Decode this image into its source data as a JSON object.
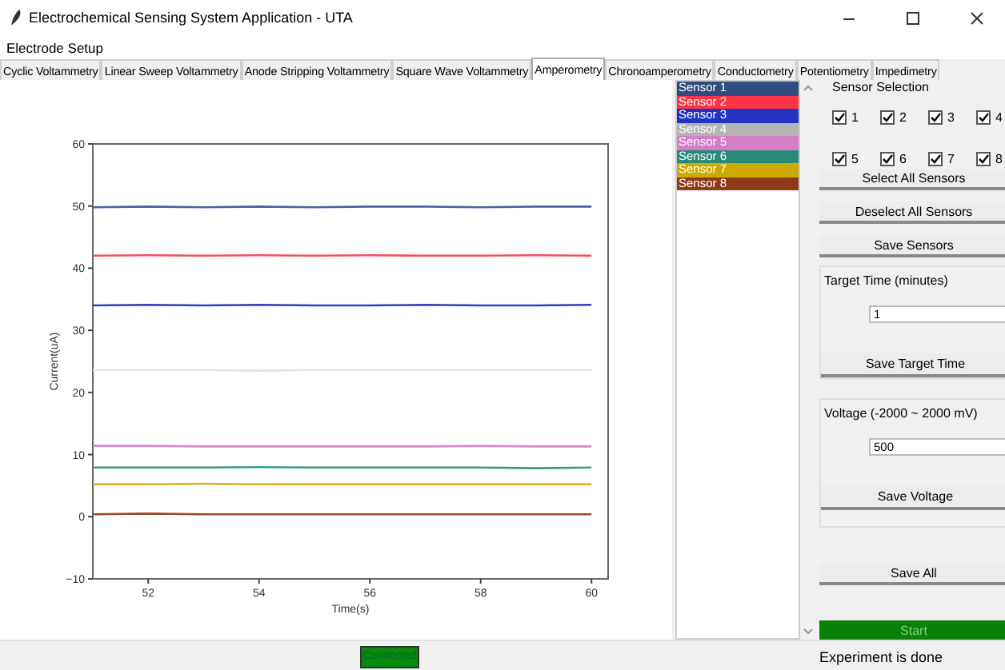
{
  "window": {
    "title": "Electrochemical Sensing System Application - UTA"
  },
  "menu": [
    "Electrode Setup"
  ],
  "tabs": [
    {
      "label": "Cyclic Voltammetry",
      "selected": false
    },
    {
      "label": "Linear Sweep Voltammetry",
      "selected": false
    },
    {
      "label": "Anode Stripping Voltammetry",
      "selected": false
    },
    {
      "label": "Square Wave Voltammetry",
      "selected": false
    },
    {
      "label": "Amperometry",
      "selected": true
    },
    {
      "label": "Chronoamperometry",
      "selected": false
    },
    {
      "label": "Conductometry",
      "selected": false
    },
    {
      "label": "Potentiometry",
      "selected": false
    },
    {
      "label": "Impedimetry",
      "selected": false
    }
  ],
  "plot": {
    "chart_data": {
      "type": "line",
      "xlabel": "Time(s)",
      "ylabel": "Current(uA)",
      "x": [
        51,
        52,
        53,
        54,
        55,
        56,
        57,
        58,
        59,
        60
      ],
      "xlim": [
        51,
        60.3
      ],
      "ylim": [
        -10,
        60
      ],
      "xticks": [
        52,
        54,
        56,
        58,
        60
      ],
      "yticks": [
        -10,
        0,
        10,
        20,
        30,
        40,
        50,
        60
      ],
      "series": [
        {
          "color": "#4a64a0",
          "values": [
            49.8,
            49.9,
            49.8,
            49.9,
            49.8,
            49.9,
            49.9,
            49.8,
            49.9,
            49.9
          ]
        },
        {
          "color": "#ff4a5a",
          "values": [
            42.0,
            42.1,
            42.0,
            42.1,
            42.0,
            42.1,
            42.0,
            42.0,
            42.1,
            42.0
          ]
        },
        {
          "color": "#3040c0",
          "values": [
            34.0,
            34.1,
            34.0,
            34.1,
            34.0,
            34.0,
            34.1,
            34.0,
            34.0,
            34.1
          ]
        },
        {
          "color": "#e4e4e4",
          "values": [
            23.6,
            23.6,
            23.6,
            23.5,
            23.6,
            23.6,
            23.6,
            23.6,
            23.6,
            23.6
          ]
        },
        {
          "color": "#d48cd0",
          "values": [
            11.4,
            11.4,
            11.3,
            11.3,
            11.3,
            11.3,
            11.3,
            11.4,
            11.3,
            11.3
          ]
        },
        {
          "color": "#3a9a86",
          "values": [
            7.9,
            7.9,
            7.9,
            8.0,
            7.9,
            7.9,
            7.9,
            7.9,
            7.8,
            7.9
          ]
        },
        {
          "color": "#d4b020",
          "values": [
            5.2,
            5.2,
            5.3,
            5.2,
            5.2,
            5.2,
            5.2,
            5.2,
            5.2,
            5.2
          ]
        },
        {
          "color": "#9a4a2a",
          "values": [
            0.4,
            0.5,
            0.4,
            0.4,
            0.4,
            0.4,
            0.4,
            0.4,
            0.4,
            0.4
          ]
        }
      ]
    }
  },
  "sensor_list": [
    {
      "label": "Sensor 1",
      "color": "#2f4c7e"
    },
    {
      "label": "Sensor 2",
      "color": "#ff3344"
    },
    {
      "label": "Sensor 3",
      "color": "#2233c0"
    },
    {
      "label": "Sensor 4",
      "color": "#b4b4b4"
    },
    {
      "label": "Sensor 5",
      "color": "#d47ec8"
    },
    {
      "label": "Sensor 6",
      "color": "#2a8a78"
    },
    {
      "label": "Sensor 7",
      "color": "#ccaa00"
    },
    {
      "label": "Sensor 8",
      "color": "#8e3a1a"
    }
  ],
  "sensor_selection": {
    "title": "Sensor Selection",
    "checkboxes": [
      {
        "label": "1",
        "checked": true
      },
      {
        "label": "2",
        "checked": true
      },
      {
        "label": "3",
        "checked": true
      },
      {
        "label": "4",
        "checked": true
      },
      {
        "label": "5",
        "checked": true
      },
      {
        "label": "6",
        "checked": true
      },
      {
        "label": "7",
        "checked": true
      },
      {
        "label": "8",
        "checked": true
      }
    ]
  },
  "sensor_buttons": [
    "Select All Sensors",
    "Deselect All Sensors",
    "Save Sensors"
  ],
  "target_time": {
    "label": "Target Time (minutes)",
    "value": "1",
    "button": "Save Target Time"
  },
  "voltage": {
    "label": "Voltage (-2000 ~ 2000 mV)",
    "value": "500",
    "button": "Save Voltage"
  },
  "save_all": "Save All",
  "start": "Start",
  "status_bar": {
    "connection": "Connected",
    "message": "Experiment is done"
  }
}
